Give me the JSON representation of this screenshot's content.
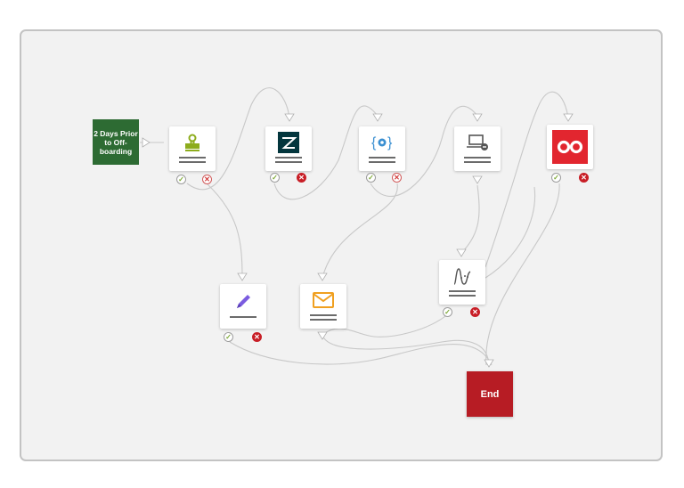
{
  "trigger": {
    "label": "2 Days Prior to Off-boarding"
  },
  "end": {
    "label": "End"
  },
  "status": {
    "success_glyph": "✓",
    "failure_glyph": "✕"
  },
  "nodes": [
    {
      "id": "n1",
      "icon": "stamp-icon"
    },
    {
      "id": "n2",
      "icon": "zendesk-icon"
    },
    {
      "id": "n3",
      "icon": "json-gear-icon"
    },
    {
      "id": "n4",
      "icon": "laptop-remove-icon"
    },
    {
      "id": "n5",
      "icon": "red-infinity-icon"
    },
    {
      "id": "n6",
      "icon": "pencil-icon"
    },
    {
      "id": "n7",
      "icon": "mail-icon"
    },
    {
      "id": "n8",
      "icon": "formula-graph-icon"
    }
  ],
  "colors": {
    "trigger": "#2d6b33",
    "end": "#b71c24",
    "canvas": "#f2f2f2",
    "wire": "#c8c8c8"
  }
}
